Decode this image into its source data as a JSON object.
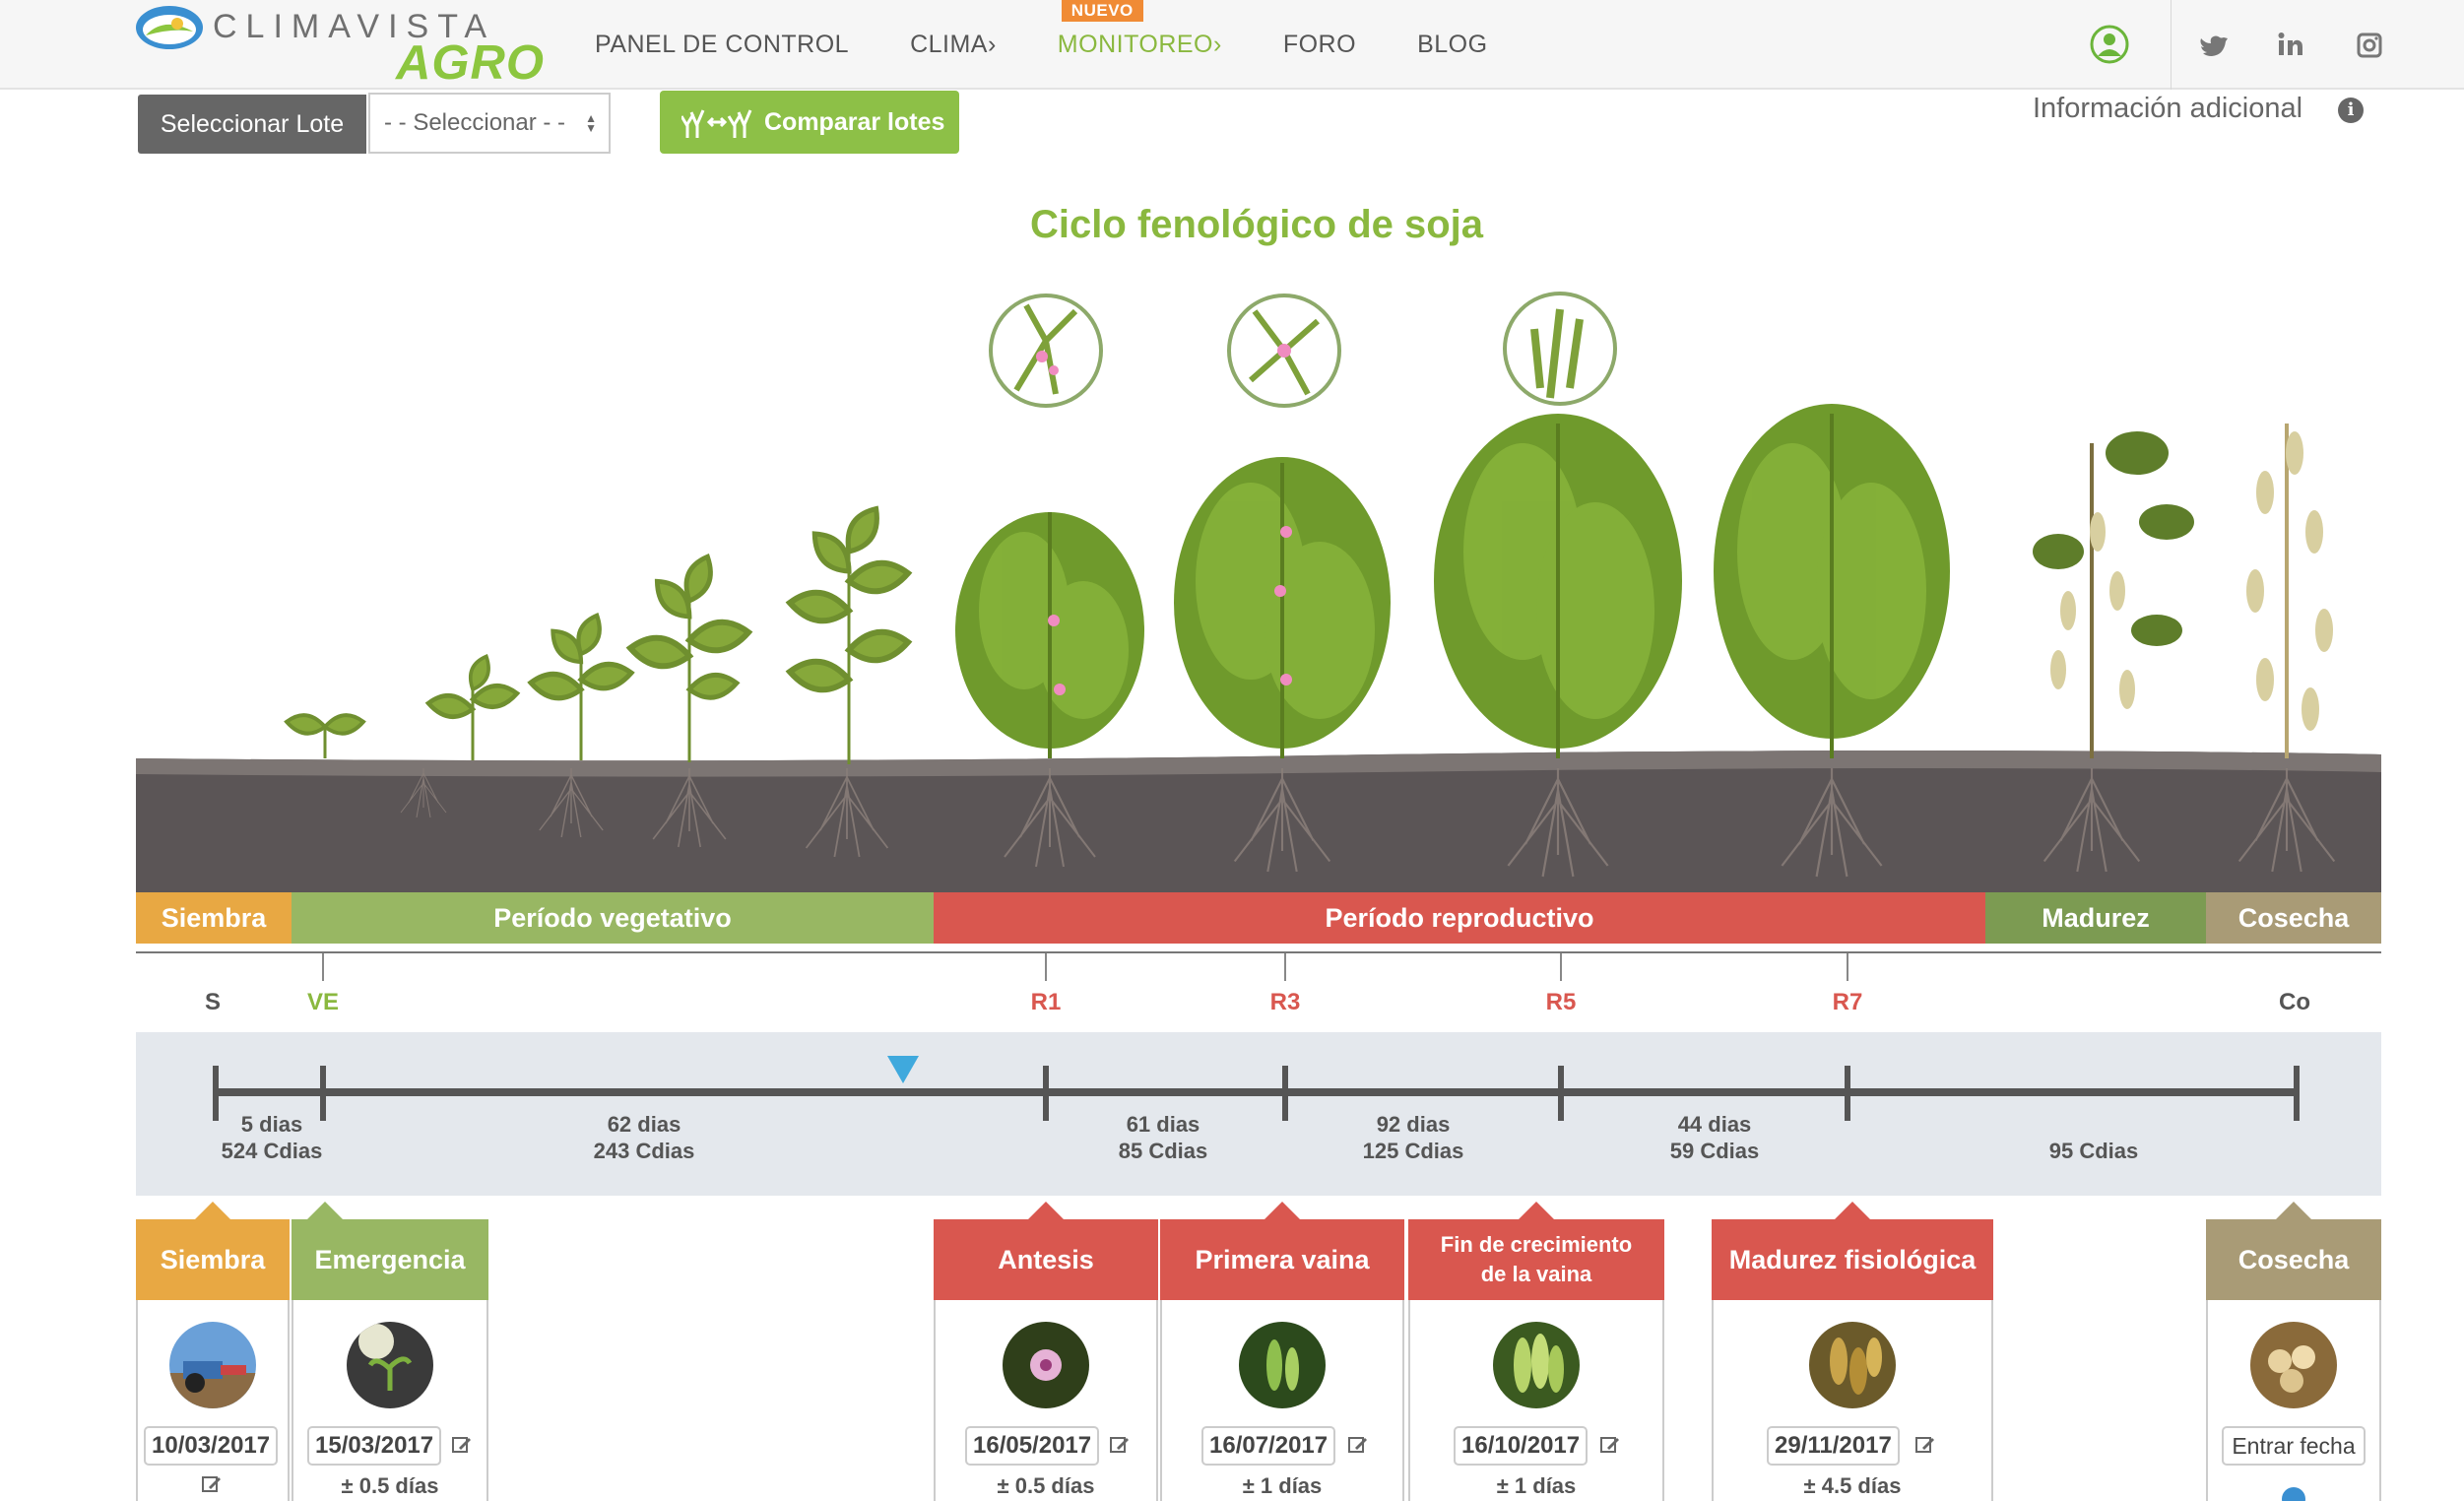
{
  "brand": {
    "top": "CLIMAVISTA",
    "bottom": "AGRO",
    "green": "#8cc63f",
    "blue": "#3a8fd1"
  },
  "nav": {
    "items": [
      {
        "label": "PANEL DE CONTROL"
      },
      {
        "label": "CLIMA›"
      },
      {
        "label": "MONITOREO›",
        "badge": "NUEVO",
        "active": true
      },
      {
        "label": "FORO"
      },
      {
        "label": "BLOG"
      }
    ],
    "icons": [
      "user-icon",
      "twitter-icon",
      "linkedin-icon",
      "instagram-icon"
    ]
  },
  "toolbar": {
    "lote_button": "Seleccionar Lote",
    "select_value": "- - Seleccionar - -",
    "compare_button": "Comparar lotes",
    "info_link": "Información adicional",
    "info_icon": "i"
  },
  "title": "Ciclo fenológico de soja",
  "periods": [
    {
      "label": "Siembra",
      "color": "#e8a843"
    },
    {
      "label": "Período vegetativo",
      "color": "#98b763"
    },
    {
      "label": "Período reproductivo",
      "color": "#d9574f"
    },
    {
      "label": "Madurez",
      "color": "#7c9b52"
    },
    {
      "label": "Cosecha",
      "color": "#a99b76"
    }
  ],
  "stages": [
    {
      "label": "S",
      "color": "#555555"
    },
    {
      "label": "VE",
      "color": "#8ab83f"
    },
    {
      "label": "R1",
      "color": "#d9574f"
    },
    {
      "label": "R3",
      "color": "#d9574f"
    },
    {
      "label": "R5",
      "color": "#d9574f"
    },
    {
      "label": "R7",
      "color": "#d9574f"
    },
    {
      "label": "Co",
      "color": "#555555"
    }
  ],
  "timeline": {
    "marker_color": "#3fa9dd",
    "segments": [
      {
        "days": "5 dias",
        "cdias": "524 Cdias"
      },
      {
        "days": "62 dias",
        "cdias": "243 Cdias"
      },
      {
        "days": "61 dias",
        "cdias": "85 Cdias"
      },
      {
        "days": "92 dias",
        "cdias": "125 Cdias"
      },
      {
        "days": "44 dias",
        "cdias": "59 Cdias"
      },
      {
        "days": "",
        "cdias": "95 Cdias"
      }
    ]
  },
  "cards": [
    {
      "title": "Siembra",
      "color": "#e8a843",
      "date": "10/03/2017",
      "pm": "",
      "photo": "tractor"
    },
    {
      "title": "Emergencia",
      "color": "#98b763",
      "date": "15/03/2017",
      "pm": "± 0.5 días",
      "photo": "seedling"
    },
    {
      "title": "Antesis",
      "color": "#d9574f",
      "date": "16/05/2017",
      "pm": "± 0.5 días",
      "photo": "flower"
    },
    {
      "title": "Primera vaina",
      "color": "#d9574f",
      "date": "16/07/2017",
      "pm": "± 1 días",
      "photo": "pod"
    },
    {
      "title": "Fin de crecimiento de la vaina",
      "color": "#d9574f",
      "date": "16/10/2017",
      "pm": "± 1 días",
      "photo": "pods"
    },
    {
      "title": "Madurez fisiológica",
      "color": "#d9574f",
      "date": "29/11/2017",
      "pm": "± 4.5 días",
      "photo": "mature"
    },
    {
      "title": "Cosecha",
      "color": "#a99b76",
      "entrar": "Entrar fecha",
      "photo": "beans"
    }
  ]
}
